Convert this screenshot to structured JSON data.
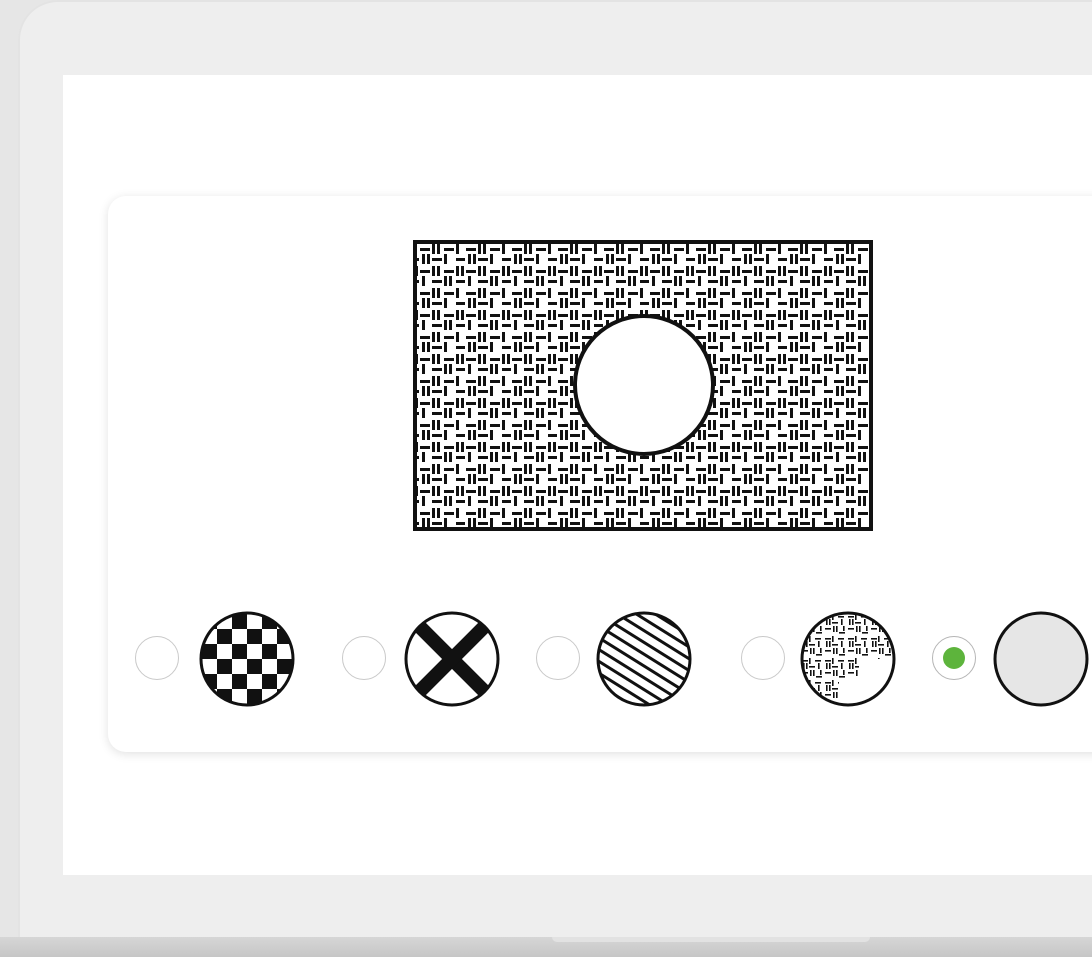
{
  "device": {
    "frame_color": "#eeeeee",
    "screen_color": "#ffffff"
  },
  "preview": {
    "pattern": "basket-weave",
    "hole": "circle"
  },
  "texture_options": [
    {
      "id": "checkerboard",
      "icon": "checkerboard-swatch-icon",
      "selected": false
    },
    {
      "id": "x-cross",
      "icon": "x-cross-swatch-icon",
      "selected": false
    },
    {
      "id": "diagonal-stripes",
      "icon": "diagonal-stripes-swatch-icon",
      "selected": false
    },
    {
      "id": "basket-weave",
      "icon": "basket-weave-swatch-icon",
      "selected": false
    },
    {
      "id": "solid-gray",
      "icon": "solid-gray-swatch-icon",
      "selected": true
    }
  ],
  "colors": {
    "selected_accent": "#5db43c",
    "solid_swatch_fill": "#e6e6e6"
  }
}
